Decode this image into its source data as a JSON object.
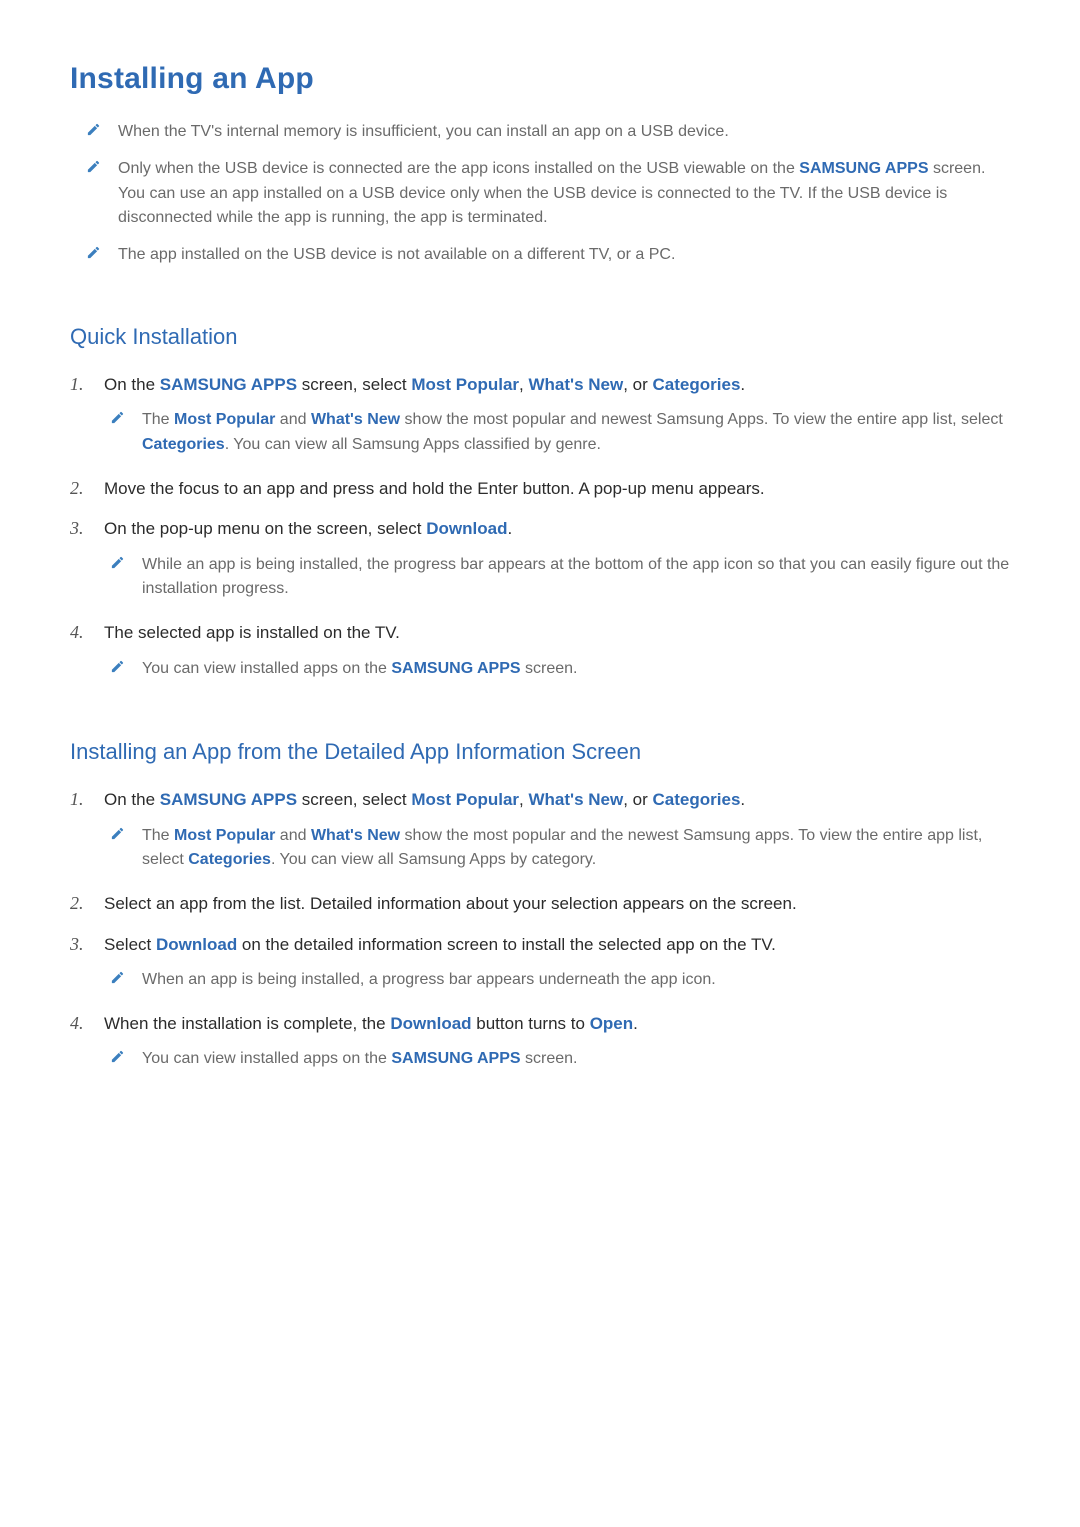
{
  "title": "Installing an App",
  "pencilColor": "#3b7fbe",
  "topNotes": [
    [
      {
        "t": "When the TV's internal memory is insufficient, you can install an app on a USB device."
      }
    ],
    [
      {
        "t": "Only when the USB device is connected are the app icons installed on the USB viewable on the "
      },
      {
        "t": "SAMSUNG APPS",
        "hl": true
      },
      {
        "t": " screen. You can use an app installed on a USB device only when the USB device is connected to the TV. If the USB device is disconnected while the app is running, the app is terminated."
      }
    ],
    [
      {
        "t": "The app installed on the USB device is not available on a different TV, or a PC."
      }
    ]
  ],
  "section1": {
    "title": "Quick Installation",
    "steps": [
      {
        "num": "1.",
        "text": [
          {
            "t": "On the "
          },
          {
            "t": "SAMSUNG APPS",
            "hl": true
          },
          {
            "t": " screen, select "
          },
          {
            "t": "Most Popular",
            "hl": true
          },
          {
            "t": ", "
          },
          {
            "t": "What's New",
            "hl": true
          },
          {
            "t": ", or "
          },
          {
            "t": "Categories",
            "hl": true
          },
          {
            "t": "."
          }
        ],
        "notes": [
          [
            {
              "t": "The "
            },
            {
              "t": "Most Popular",
              "hl": true
            },
            {
              "t": " and "
            },
            {
              "t": "What's New",
              "hl": true
            },
            {
              "t": " show the most popular and newest Samsung Apps. To view the entire app list, select "
            },
            {
              "t": "Categories",
              "hl": true
            },
            {
              "t": ". You can view all Samsung Apps classified by genre."
            }
          ]
        ]
      },
      {
        "num": "2.",
        "text": [
          {
            "t": "Move the focus to an app and press and hold the Enter button. A pop-up menu appears."
          }
        ],
        "notes": []
      },
      {
        "num": "3.",
        "text": [
          {
            "t": "On the pop-up menu on the screen, select "
          },
          {
            "t": "Download",
            "hl": true
          },
          {
            "t": "."
          }
        ],
        "notes": [
          [
            {
              "t": "While an app is being installed, the progress bar appears at the bottom of the app icon so that you can easily figure out the installation progress."
            }
          ]
        ]
      },
      {
        "num": "4.",
        "text": [
          {
            "t": "The selected app is installed on the TV."
          }
        ],
        "notes": [
          [
            {
              "t": "You can view installed apps on the "
            },
            {
              "t": "SAMSUNG APPS",
              "hl": true
            },
            {
              "t": " screen."
            }
          ]
        ]
      }
    ]
  },
  "section2": {
    "title": "Installing an App from the Detailed App Information Screen",
    "steps": [
      {
        "num": "1.",
        "text": [
          {
            "t": "On the "
          },
          {
            "t": "SAMSUNG APPS",
            "hl": true
          },
          {
            "t": " screen, select "
          },
          {
            "t": "Most Popular",
            "hl": true
          },
          {
            "t": ", "
          },
          {
            "t": "What's New",
            "hl": true
          },
          {
            "t": ", or "
          },
          {
            "t": "Categories",
            "hl": true
          },
          {
            "t": "."
          }
        ],
        "notes": [
          [
            {
              "t": "The "
            },
            {
              "t": "Most Popular",
              "hl": true
            },
            {
              "t": " and "
            },
            {
              "t": "What's New",
              "hl": true
            },
            {
              "t": " show the most popular and the newest Samsung apps. To view the entire app list, select "
            },
            {
              "t": "Categories",
              "hl": true
            },
            {
              "t": ". You can view all Samsung Apps by category."
            }
          ]
        ]
      },
      {
        "num": "2.",
        "text": [
          {
            "t": "Select an app from the list. Detailed information about your selection appears on the screen."
          }
        ],
        "notes": []
      },
      {
        "num": "3.",
        "text": [
          {
            "t": "Select "
          },
          {
            "t": "Download",
            "hl": true
          },
          {
            "t": " on the detailed information screen to install the selected app on the TV."
          }
        ],
        "notes": [
          [
            {
              "t": "When an app is being installed, a progress bar appears underneath the app icon."
            }
          ]
        ]
      },
      {
        "num": "4.",
        "text": [
          {
            "t": "When the installation is complete, the "
          },
          {
            "t": "Download",
            "hl": true
          },
          {
            "t": " button turns to "
          },
          {
            "t": "Open",
            "hl": true
          },
          {
            "t": "."
          }
        ],
        "notes": [
          [
            {
              "t": "You can view installed apps on the "
            },
            {
              "t": "SAMSUNG APPS",
              "hl": true
            },
            {
              "t": " screen."
            }
          ]
        ]
      }
    ]
  }
}
